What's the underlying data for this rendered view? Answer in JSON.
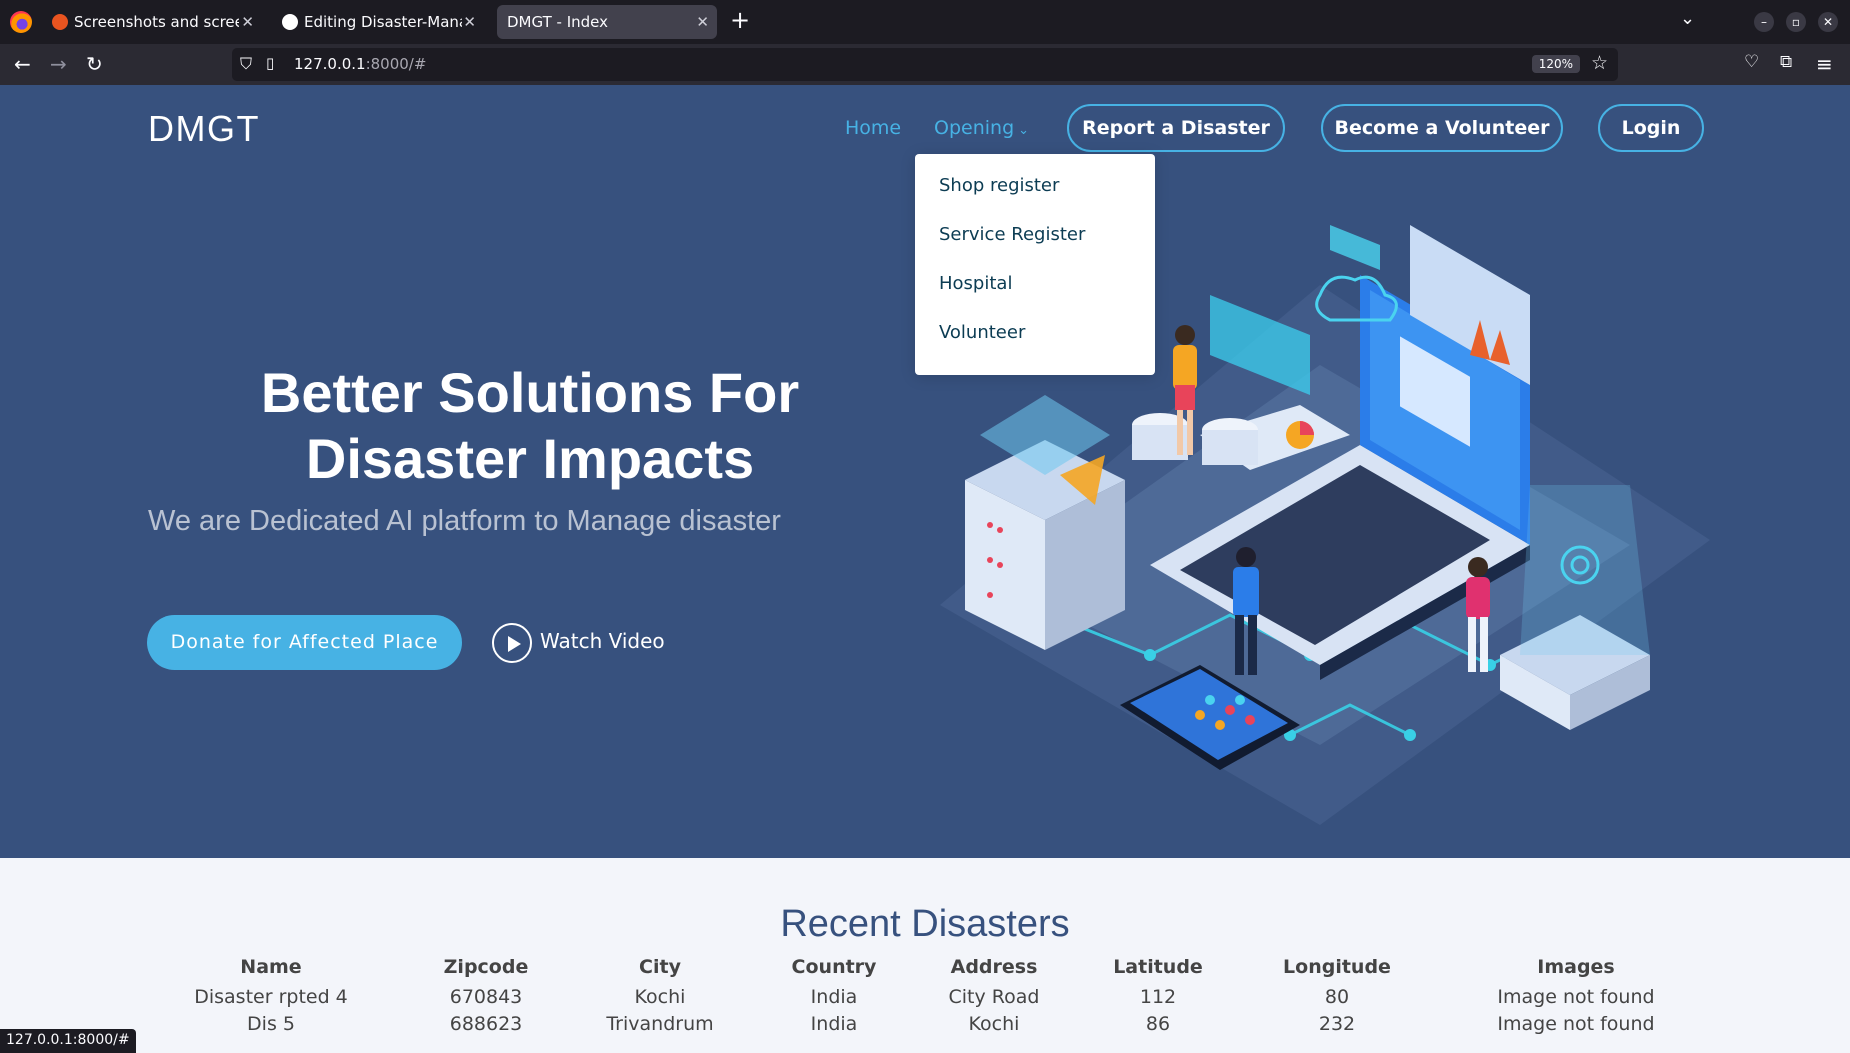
{
  "browser": {
    "tabs": [
      {
        "label": "Screenshots and screenc",
        "favicon_color": "#e95420"
      },
      {
        "label": "Editing Disaster-Manager",
        "favicon_color": "#ffffff"
      },
      {
        "label": "DMGT - Index",
        "favicon_color": ""
      }
    ],
    "url_host": "127.0.0.1",
    "url_rest": ":8000/#",
    "zoom": "120%",
    "status_url": "127.0.0.1:8000/#"
  },
  "nav": {
    "brand": "DMGT",
    "home": "Home",
    "opening": "Opening",
    "report": "Report a Disaster",
    "volunteer": "Become a Volunteer",
    "login": "Login",
    "dropdown": [
      "Shop register",
      "Service Register",
      "Hospital",
      "Volunteer"
    ]
  },
  "hero": {
    "title_line1": "Better Solutions For",
    "title_line2": "Disaster Impacts",
    "subtitle": "We are Dedicated AI platform to Manage disaster",
    "donate": "Donate for Affected Place",
    "watch": "Watch Video"
  },
  "disasters": {
    "title": "Recent Disasters",
    "columns": [
      "Name",
      "Zipcode",
      "City",
      "Country",
      "Address",
      "Latitude",
      "Longitude",
      "Images"
    ],
    "rows": [
      [
        "Disaster rpted 4",
        "670843",
        "Kochi",
        "India",
        "City Road",
        "112",
        "80",
        "Image not found"
      ],
      [
        "Dis 5",
        "688623",
        "Trivandrum",
        "India",
        "Kochi",
        "86",
        "232",
        "Image not found"
      ]
    ]
  },
  "colors": {
    "hero_bg": "#37517e",
    "accent": "#47b2e4",
    "section_bg": "#f3f5fa"
  }
}
